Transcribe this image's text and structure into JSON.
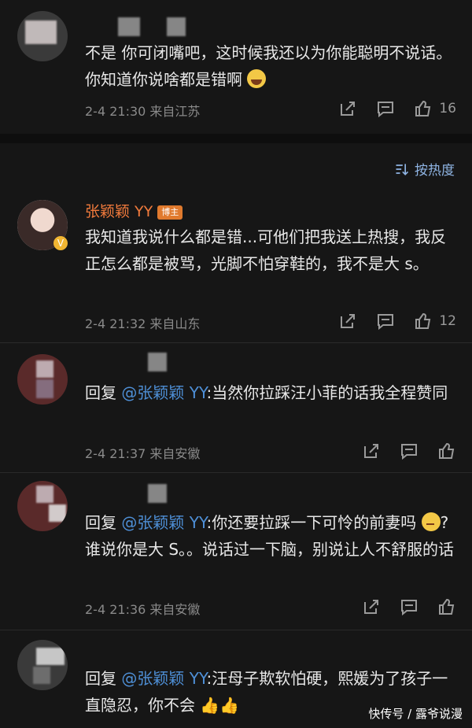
{
  "comments": [
    {
      "text": "不是 你可闭嘴吧，这时候我还以为你能聪明不说话。你知道你说啥都是错啊",
      "time": "2-4 21:30",
      "location": "来自江苏",
      "likes": "16"
    },
    {
      "name": "张颖颖 YY",
      "badge": "博主",
      "text": "我知道我说什么都是错...可他们把我送上热搜，我反正怎么都是被骂，光脚不怕穿鞋的，我不是大 s。",
      "time": "2-4 21:32",
      "location": "来自山东",
      "likes": "12"
    },
    {
      "reply_prefix": "回复 ",
      "reply_name": "@张颖颖 YY",
      "text": ":当然你拉踩汪小菲的话我全程赞同",
      "time": "2-4 21:37",
      "location": "来自安徽",
      "likes": ""
    },
    {
      "reply_prefix": "回复 ",
      "reply_name": "@张颖颖 YY",
      "text": ":你还要拉踩一下可怜的前妻吗",
      "text2": "?谁说你是大 S。。说话过一下脑，别说让人不舒服的话",
      "time": "2-4 21:36",
      "location": "来自安徽",
      "likes": ""
    },
    {
      "reply_prefix": "回复 ",
      "reply_name": "@张颖颖 YY",
      "text": ":汪母子欺软怕硬，熙媛为了孩子一直隐忍，你不会"
    }
  ],
  "sort_label": "按热度",
  "watermark": "快传号 / 露爷说漫",
  "icons": {
    "share": "share-icon",
    "comment": "comment-icon",
    "like": "thumbs-up-icon",
    "sort": "sort-icon",
    "verified": "verified-icon"
  }
}
